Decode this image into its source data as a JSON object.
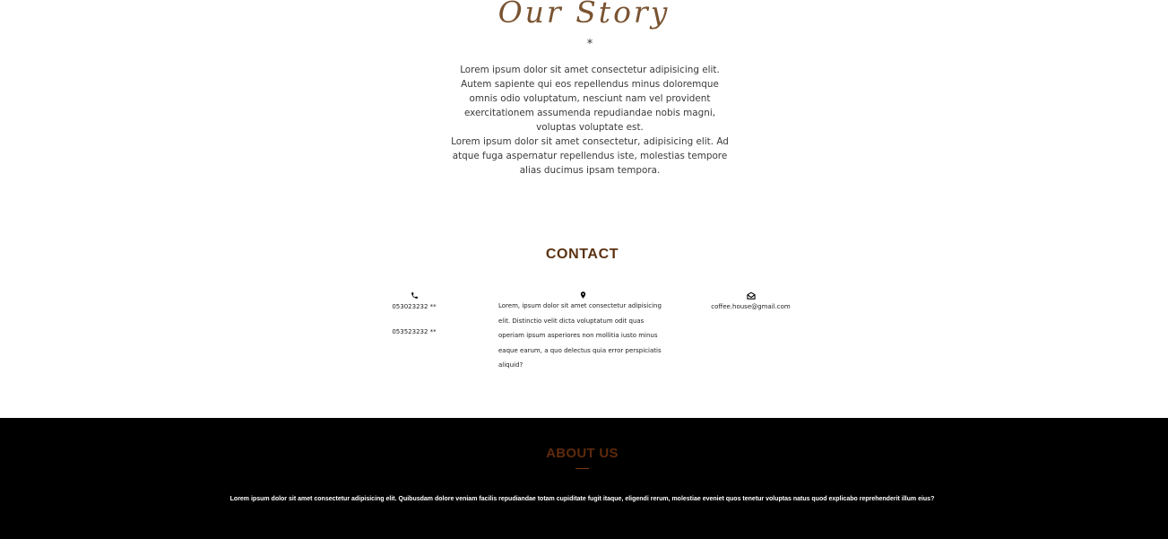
{
  "story": {
    "title": "Our Story",
    "divider": "*",
    "paragraph_1": "Lorem ipsum dolor sit amet consectetur adipisicing elit. Autem sapiente qui eos repellendus minus doloremque omnis odio voluptatum, nesciunt nam vel provident exercitationem assumenda repudiandae nobis magni, voluptas voluptate est.",
    "paragraph_2": "Lorem ipsum dolor sit amet consectetur, adipisicing elit. Ad atque fuga aspernatur repellendus iste, molestias tempore alias ducimus ipsam tempora."
  },
  "contact": {
    "title": "CONTACT",
    "phone_icon": "phone-icon",
    "phones": [
      "053023232 **",
      "053523232 **"
    ],
    "address_icon": "map-pin-icon",
    "address": "Lorem, ipsum dolor sit amet consectetur adipisicing elit. Distinctio velit dicta voluptatum odit quas operiam ipsum asperiores non mollitia iusto minus eaque earum, a quo delectus quia error perspiciatis aliquid?",
    "email_icon": "envelope-open-icon",
    "email": "coffee.house@gmail.com"
  },
  "about": {
    "title": "ABOUT US",
    "text": "Lorem ipsum dolor sit amet consectetur adipisicing elit. Quibusdam dolore veniam facilis repudiandae totam cupiditate fugit itaque, eligendi rerum, molestiae eveniet quos tenetur voluptas natus quod explicabo reprehenderit illum eius?"
  },
  "colors": {
    "story_title": "#7a5432",
    "heading_brown": "#5b3213",
    "about_title": "#5e2a0c",
    "footer_bg": "#000000"
  }
}
